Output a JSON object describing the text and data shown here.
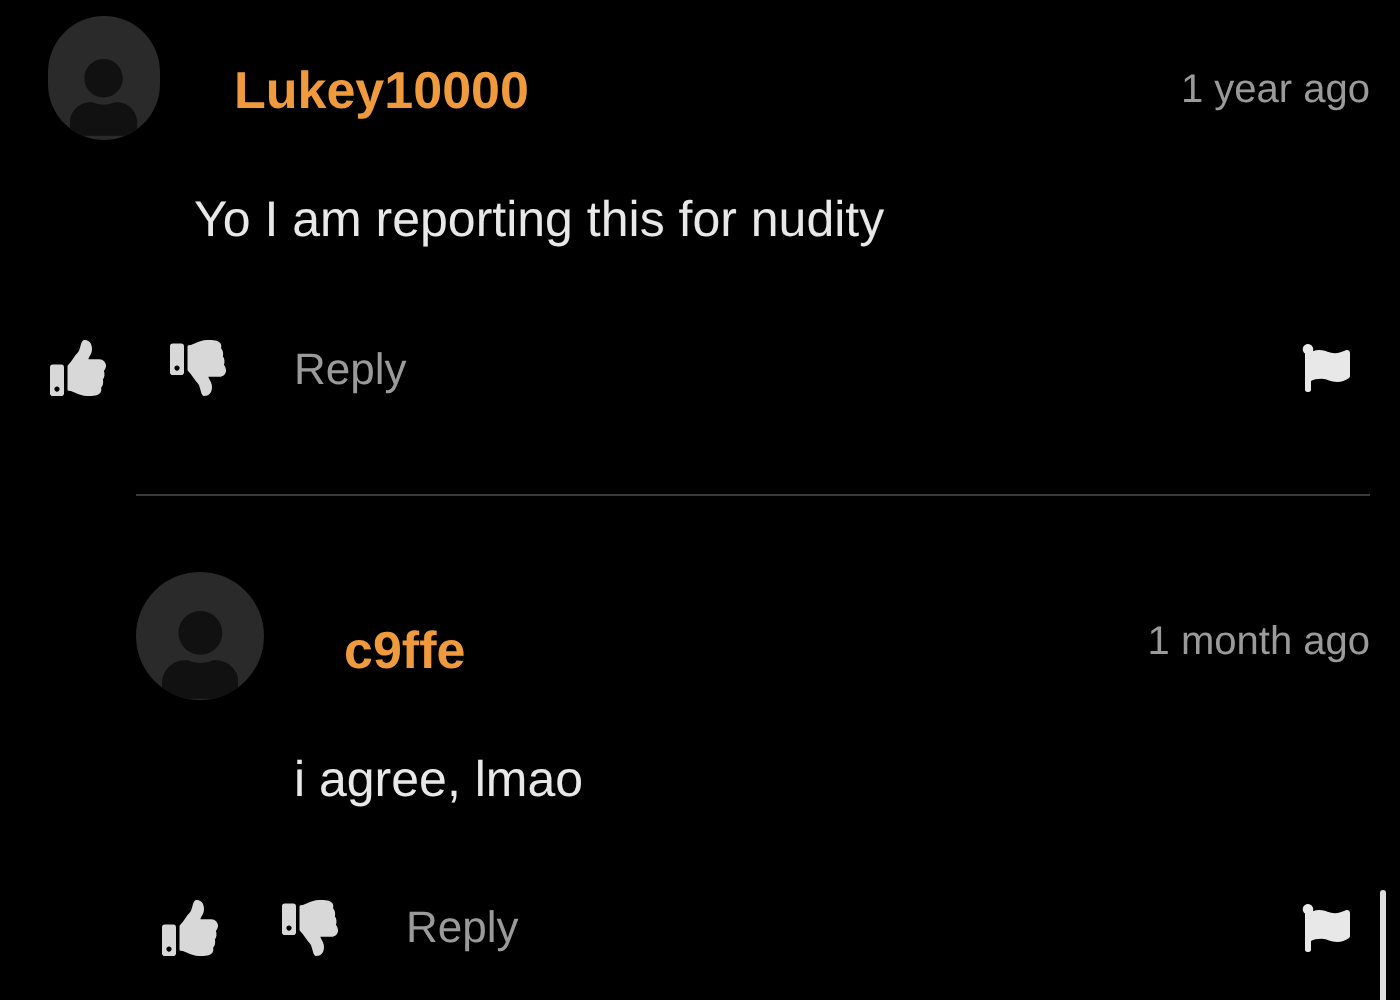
{
  "comments": [
    {
      "username": "Lukey10000",
      "time": "1 year ago",
      "text": "Yo I am reporting this for nudity",
      "reply_label": "Reply",
      "children": [
        {
          "username": "c9ffe",
          "time": "1 month ago",
          "text": "i agree, lmao",
          "reply_label": "Reply"
        }
      ]
    }
  ]
}
